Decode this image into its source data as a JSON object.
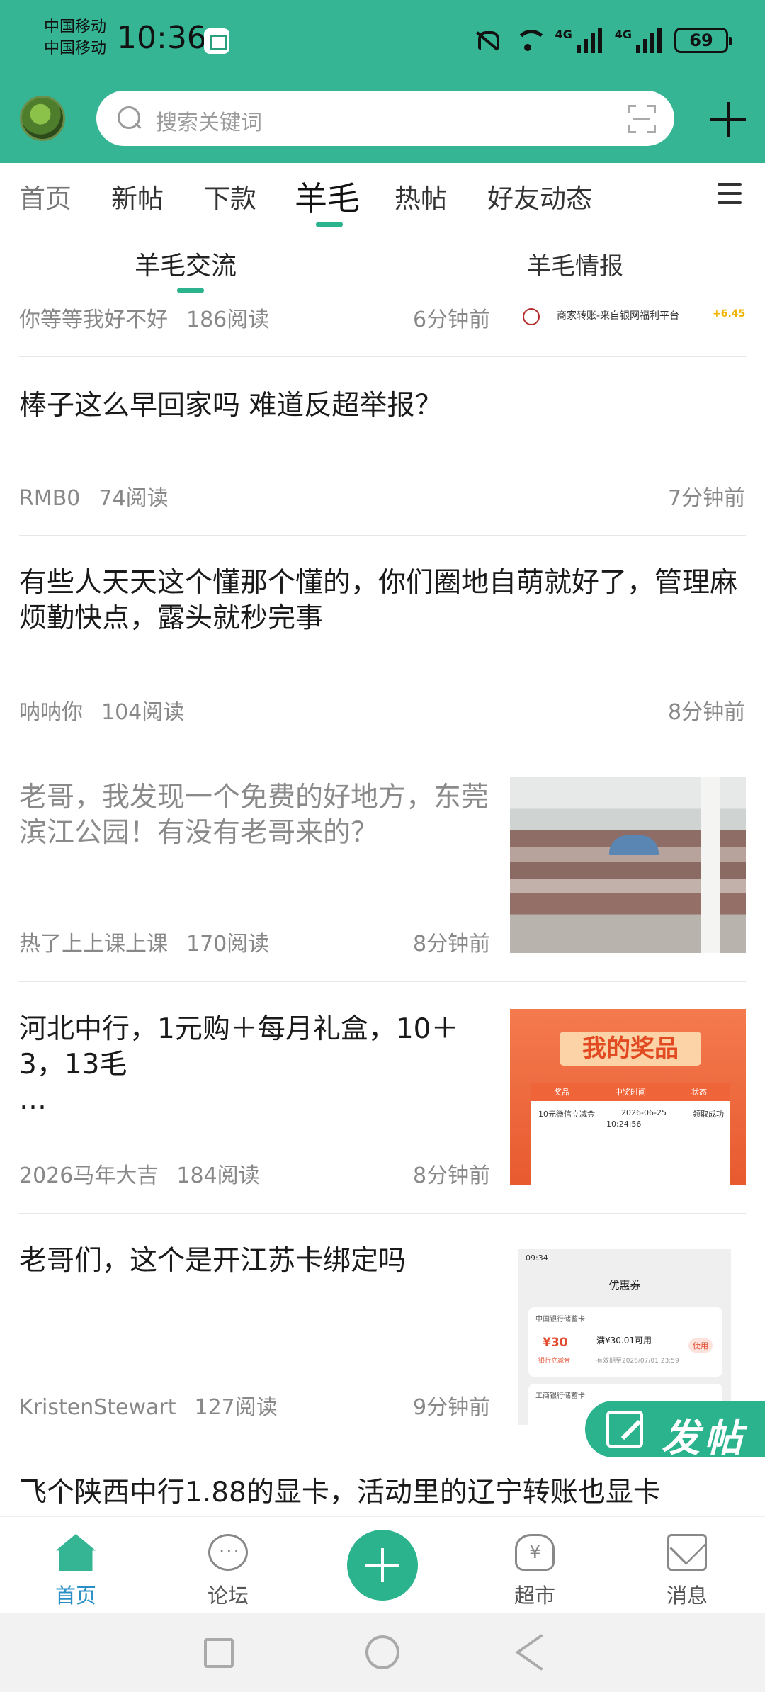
{
  "status_bar": {
    "carrier_1": "中国移动",
    "carrier_2": "中国移动",
    "time": "10:36",
    "network_1": "4G",
    "network_2": "4G",
    "battery": "69"
  },
  "search": {
    "placeholder": "搜索关键词"
  },
  "tabs": [
    {
      "label": "首页"
    },
    {
      "label": "新帖"
    },
    {
      "label": "下款"
    },
    {
      "label": "羊毛",
      "active": true
    },
    {
      "label": "热帖"
    },
    {
      "label": "好友动态"
    }
  ],
  "sub_tabs": [
    {
      "label": "羊毛交流",
      "active": true
    },
    {
      "label": "羊毛情报"
    }
  ],
  "posts": [
    {
      "title": "",
      "author": "你等等我好不好",
      "views": "186阅读",
      "time": "6分钟前",
      "thumb_text": "商家转账-来自银网福利平台",
      "thumb_amount": "+6.45"
    },
    {
      "title": "棒子这么早回家吗 难道反超举报？",
      "author": "RMB0",
      "views": "74阅读",
      "time": "7分钟前"
    },
    {
      "title": "有些人天天这个懂那个懂的，你们圈地自萌就好了，管理麻烦勤快点，露头就秒完事",
      "author": "呐呐你",
      "views": "104阅读",
      "time": "8分钟前"
    },
    {
      "title": "老哥，我发现一个免费的好地方，东莞滨江公园！有没有老哥来的？",
      "author": "热了上上课上课",
      "views": "170阅读",
      "time": "8分钟前",
      "read": true
    },
    {
      "title": "河北中行，1元购＋每月礼盒，10＋3，13毛\n…",
      "author": "2026马年大吉",
      "views": "184阅读",
      "time": "8分钟前",
      "thumb_banner": "我的奖品",
      "thumb_headers": [
        "奖品",
        "中奖时间",
        "状态"
      ],
      "thumb_prize": "10元微信立减金",
      "thumb_date": "2026-06-25",
      "thumb_clock": "10:24:56",
      "thumb_status": "领取成功"
    },
    {
      "title": "老哥们，这个是开江苏卡绑定吗",
      "author": "KristenStewart",
      "views": "127阅读",
      "time": "9分钟前",
      "thumb_time": "09:34",
      "thumb_title": "优惠券",
      "thumb_bank1": "中国银行储蓄卡",
      "thumb_amount": "¥30",
      "thumb_amount_note": "银行立减金",
      "thumb_condition": "满¥30.01可用",
      "thumb_validity": "有效期至2026/07/01 23:59",
      "thumb_use": "使用",
      "thumb_bank2": "工商银行储蓄卡"
    },
    {
      "title": "飞个陕西中行1.88的显卡，活动里的辽宁转账也显卡"
    }
  ],
  "fab": {
    "label": "发帖"
  },
  "bottom_nav": [
    {
      "label": "首页",
      "icon": "home-icon",
      "active": true
    },
    {
      "label": "论坛",
      "icon": "chat-icon"
    },
    {
      "label": "超市",
      "icon": "market-icon"
    },
    {
      "label": "消息",
      "icon": "mail-icon"
    }
  ],
  "colors": {
    "brand": "#35b594",
    "accent": "#2bb38e",
    "active_nav": "#2a8fc4"
  }
}
